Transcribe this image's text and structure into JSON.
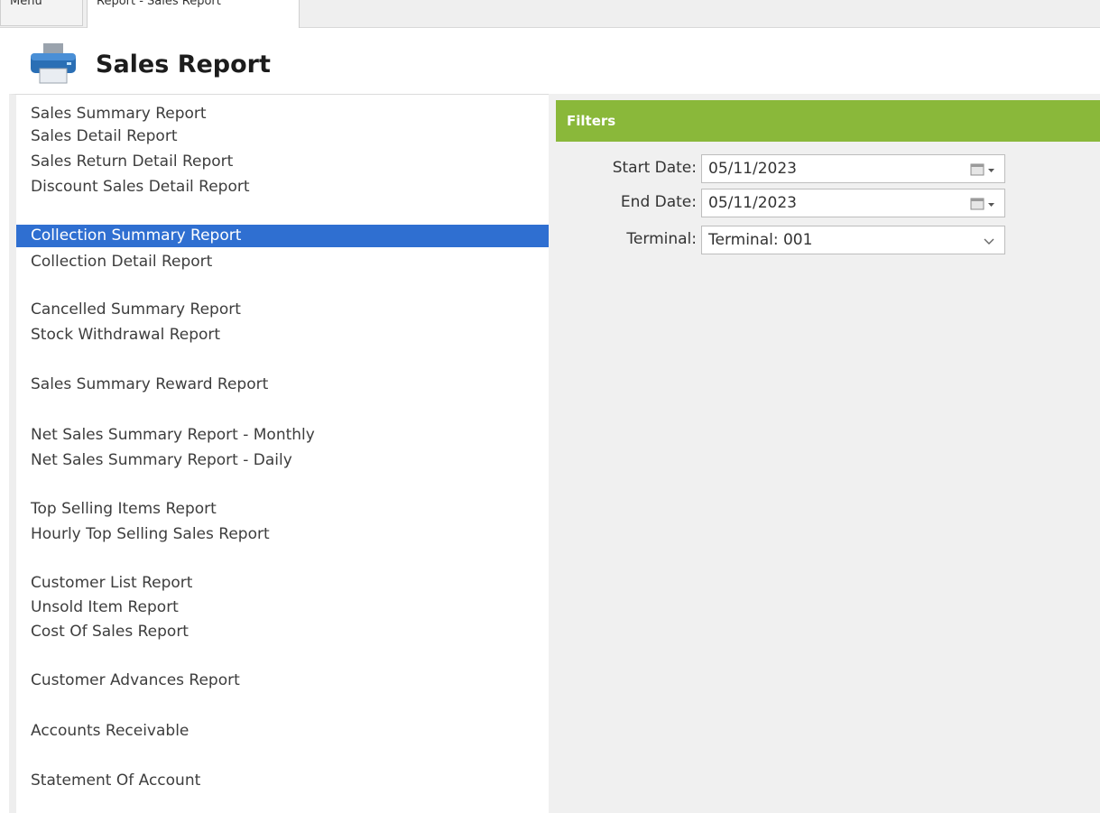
{
  "tabs": [
    {
      "label": "Menu"
    },
    {
      "label": "Report - Sales Report"
    }
  ],
  "header": {
    "title": "Sales Report",
    "icon": "printer-icon"
  },
  "report_list": {
    "selected": "Collection Summary Report",
    "items": [
      {
        "label": "Sales Summary Report"
      },
      {
        "label": "Sales Detail Report"
      },
      {
        "label": "Sales Return Detail Report"
      },
      {
        "label": "Discount Sales Detail Report"
      },
      {
        "label": "Collection Summary Report"
      },
      {
        "label": "Collection Detail Report"
      },
      {
        "label": "Cancelled Summary Report"
      },
      {
        "label": "Stock Withdrawal Report"
      },
      {
        "label": "Sales Summary Reward Report"
      },
      {
        "label": "Net Sales Summary Report - Monthly"
      },
      {
        "label": "Net Sales Summary Report - Daily"
      },
      {
        "label": "Top Selling Items Report"
      },
      {
        "label": "Hourly Top Selling Sales Report"
      },
      {
        "label": "Customer List Report"
      },
      {
        "label": "Unsold Item Report"
      },
      {
        "label": "Cost Of Sales Report"
      },
      {
        "label": "Customer Advances Report"
      },
      {
        "label": "Accounts Receivable"
      },
      {
        "label": "Statement Of Account"
      }
    ]
  },
  "filters": {
    "title": "Filters",
    "start_date": {
      "label": "Start Date:",
      "value": "05/11/2023"
    },
    "end_date": {
      "label": "End Date:",
      "value": "05/11/2023"
    },
    "terminal": {
      "label": "Terminal:",
      "value": "Terminal: 001"
    }
  },
  "colors": {
    "selection": "#2f6fd1",
    "filters_header": "#8ab83a",
    "right_pane_bg": "#f0f0f0"
  }
}
